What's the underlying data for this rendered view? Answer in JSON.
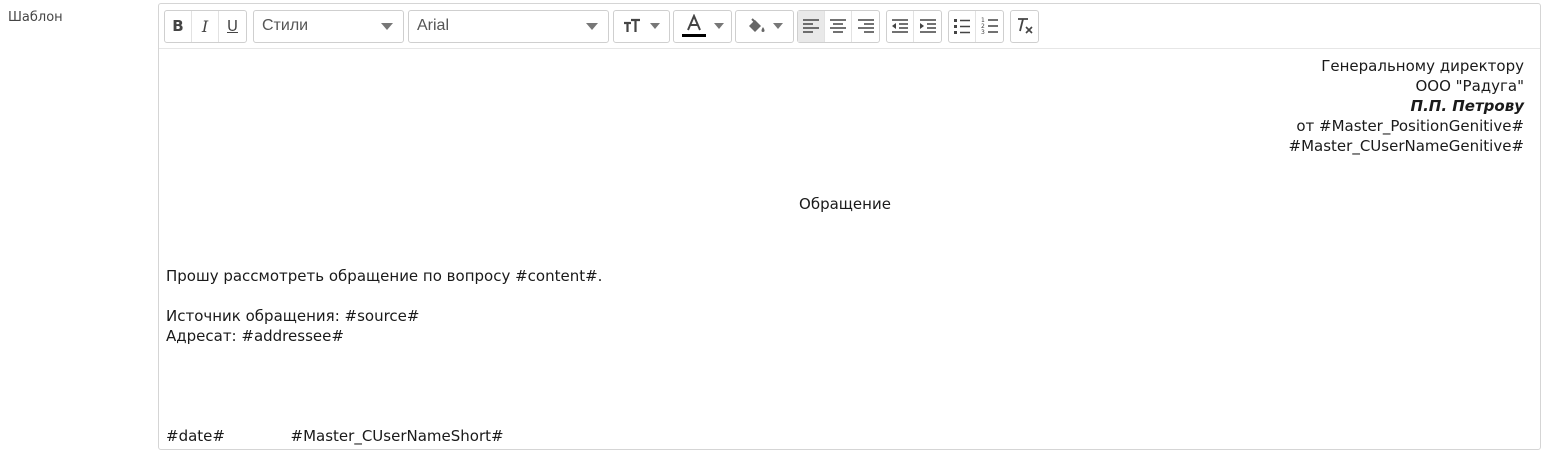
{
  "field": {
    "label": "Шаблон"
  },
  "toolbar": {
    "bold_label": "B",
    "italic_label": "I",
    "underline_label": "U",
    "styles_value": "Стили",
    "font_value": "Arial",
    "text_color": "#000000",
    "icons": [
      "bold-icon",
      "italic-icon",
      "underline-icon",
      "font-size-icon",
      "text-color-icon",
      "background-color-icon",
      "align-left-icon",
      "align-center-icon",
      "align-right-icon",
      "outdent-icon",
      "indent-icon",
      "bulleted-list-icon",
      "numbered-list-icon",
      "clear-format-icon"
    ]
  },
  "document": {
    "addressee_lines": [
      "Генеральному директору",
      "ООО \"Радуга\"",
      "П.П. Петрову",
      "от #Master_PositionGenitive#",
      "#Master_CUserNameGenitive#"
    ],
    "heading": "Обращение",
    "body_line1": "Прошу рассмотреть обращение по вопросу #content#.",
    "source_line": "Источник обращения: #source#",
    "addressee_line": "Адресат: #addressee#",
    "footer_date": "#date#",
    "footer_name": "#Master_CUserNameShort#"
  }
}
